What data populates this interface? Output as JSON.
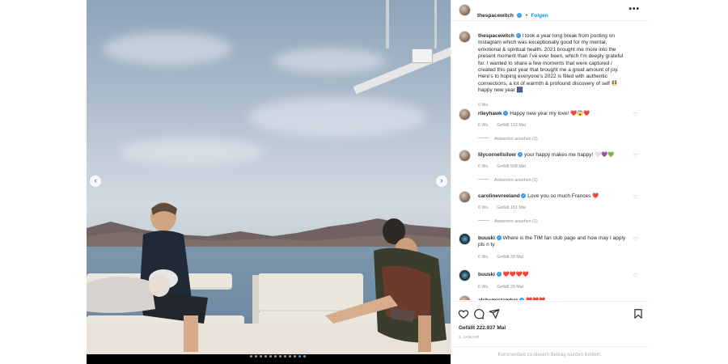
{
  "post": {
    "username": "thespacewitch",
    "follow_label": "Folgen",
    "more_label": "•••",
    "caption": "I took a year long break from posting on Instagram which was exceptionally good for my mental, emotional & spiritual health. 2021 brought me more into the present moment than I’ve ever been, which I’m deeply grateful for. I wanted to share a few moments that were captured / created this past year that brought me a great amount of joy. Here’s to hoping everyone’s 2022 is filled with authentic connections, a lot of warmth & profound discovery of self 👯 happy new year 🎆",
    "caption_time": "6 Wo.",
    "carousel": {
      "slide_count": 12,
      "active_index": 10
    },
    "prev_icon": "chevron-left-icon",
    "next_icon": "chevron-right-icon"
  },
  "comments": [
    {
      "user": "rileyhawk",
      "text": "Happy new year my love! ❤️😱❤️",
      "time": "6 Wo.",
      "likes": "Gefällt 153 Mal",
      "replies": "Antworten ansehen (1)"
    },
    {
      "user": "lilycornellsilver",
      "text": "your happy makes me happy! 🤍💜💚",
      "time": "6 Wo.",
      "likes": "Gefällt 508 Mal",
      "replies": "Antworten ansehen (1)"
    },
    {
      "user": "carolinevreeland",
      "text": "Love you so much Frances ❤️",
      "time": "6 Wo.",
      "likes": "Gefällt 161 Mal",
      "replies": "Antworten ansehen (1)"
    },
    {
      "user": "buuski",
      "text": "Where is the TIM fan club page and how may I apply pls n ty",
      "time": "6 Wo.",
      "likes": "Gefällt 28 Mal",
      "replies": ""
    },
    {
      "user": "buuski",
      "text": "❤️❤️❤️❤️",
      "time": "6 Wo.",
      "likes": "Gefällt 29 Mal",
      "replies": ""
    },
    {
      "user": "alchemistamber",
      "text": "❤️❤️❤️",
      "time": "",
      "likes": "",
      "replies": ""
    }
  ],
  "actions": {
    "like_icon": "heart-icon",
    "comment_icon": "comment-icon",
    "share_icon": "share-icon",
    "save_icon": "bookmark-icon"
  },
  "likes_text": "Gefällt 222.937 Mal",
  "date_text": "2. JANUAR",
  "comments_disabled": "Kommentare zu diesem Beitrag wurden limitiert.",
  "colors": {
    "accent": "#0095f6",
    "verified": "#3897f0",
    "heart": "#ed4956",
    "muted": "#8e8e8e"
  }
}
